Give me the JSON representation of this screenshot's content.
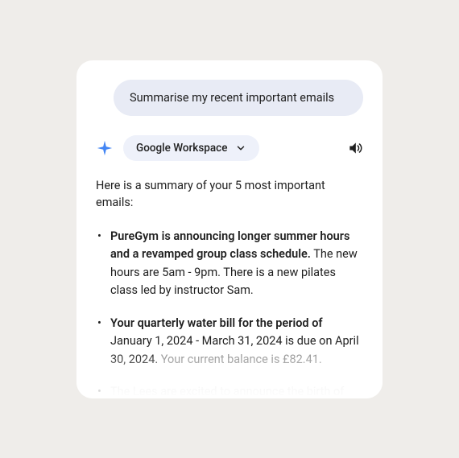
{
  "prompt": {
    "text": "Summarise my recent important emails"
  },
  "toolbar": {
    "chip_label": "Google Workspace"
  },
  "response": {
    "intro": "Here is a summary of your 5 most important emails:",
    "emails": [
      {
        "bold": "PureGym is announcing longer summer hours and a revamped group class schedule.",
        "rest": " The new hours are 5am - 9pm. There is a new pilates class led by instructor Sam."
      },
      {
        "bold": "Your quarterly water bill for the period of",
        "rest": " January 1, 2024 - March 31, 2024 is due on April 30, 2024.",
        "gray": " Your current balance is £82.41."
      },
      {
        "faded": "The Lees are excited to announce the birth of"
      }
    ]
  }
}
